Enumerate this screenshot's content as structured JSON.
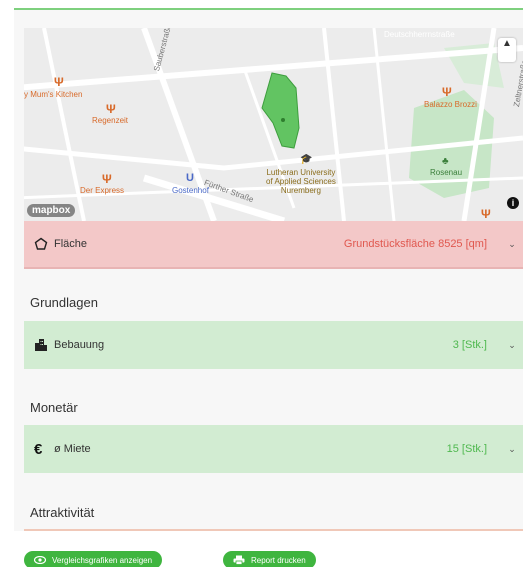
{
  "map": {
    "labels": {
      "top_street": "Deutschherrnstraße",
      "kitchen": "y Mum's Kitchen",
      "regenzeit": "Regenzeit",
      "sauberstrasse": "Sauberstraße",
      "balazzo": "Balazzo Brozzi",
      "zeltnerstrasse": "Zeltnerstraße",
      "university": "Lutheran University\nof Applied Sciences\nNuremberg",
      "rosenau": "Rosenau",
      "der_express": "Der Express",
      "gostenhof": "Gostenhof",
      "fuerther": "Fürther Straße",
      "mapbox": "mapbox"
    },
    "compass": "▲",
    "info": "i"
  },
  "flaeche": {
    "label": "Fläche",
    "value": "Grundstücksfläche 8525 [qm]"
  },
  "sections": {
    "grundlagen": "Grundlagen",
    "monetaer": "Monetär",
    "attraktivitaet": "Attraktivität"
  },
  "bebauung": {
    "label": "Bebauung",
    "value": "3 [Stk.]"
  },
  "miete": {
    "icon": "€",
    "label": "ø Miete",
    "value": "15 [Stk.]"
  },
  "buttons": {
    "compare": "Vergleichsgrafiken anzeigen",
    "print": "Report drucken"
  },
  "colors": {
    "accent_green": "#3fb53f",
    "alert_red": "#e0584f"
  }
}
